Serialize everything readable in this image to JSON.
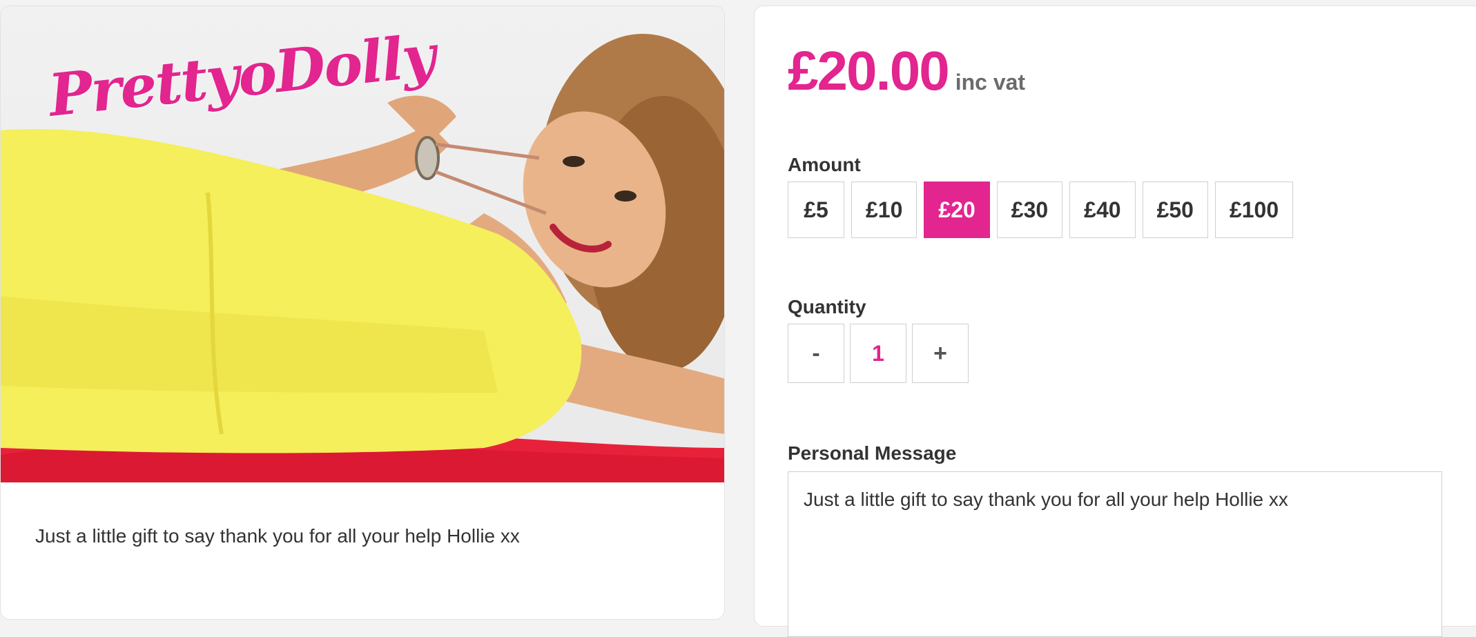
{
  "preview": {
    "logo_text": "PrettyoDolly",
    "message": "Just a little gift to say thank you for all your help Hollie xx"
  },
  "options": {
    "price": "£20.00",
    "price_suffix": "inc vat",
    "amount_label": "Amount",
    "amounts": [
      "£5",
      "£10",
      "£20",
      "£30",
      "£40",
      "£50",
      "£100"
    ],
    "selected_amount": "£20",
    "quantity_label": "Quantity",
    "quantity_minus": "-",
    "quantity_value": "1",
    "quantity_plus": "+",
    "message_label": "Personal Message",
    "message_value": "Just a little gift to say thank you for all your help Hollie xx"
  },
  "colors": {
    "accent": "#e2258f",
    "dress": "#f4ef5a",
    "sheet": "#e8213a"
  }
}
